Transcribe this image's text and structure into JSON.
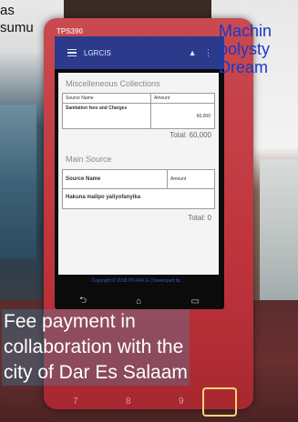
{
  "device": {
    "model": "TPS390",
    "app": {
      "title": "LGRCIS",
      "actions": "▲ ⋮"
    },
    "misc": {
      "title": "Miscelleneous Collections",
      "headers": [
        "Source Name",
        "Amount"
      ],
      "row_name": "Sanitation fees and Charges",
      "row_amount": "60,000",
      "total": "Total: 60,000"
    },
    "main": {
      "title": "Main Source",
      "headers": [
        "Source Name",
        "Amount"
      ],
      "empty_message": "Hakuna malipo yaliyofanyika",
      "total": "Total: 0"
    },
    "footer_link": "Copyright © 2018 PO-RALG | Developed by ...",
    "nav_icons": [
      "back-icon",
      "home-icon",
      "recents-icon"
    ]
  },
  "captions": {
    "top_left_1": "as",
    "top_left_2": "sumu",
    "top_right_1": "Machin",
    "top_right_2": "polysty",
    "top_right_3": "Dream",
    "bottom_1": "Fee payment in",
    "bottom_2": "collaboration with the",
    "bottom_3": "city of Dar Es Salaam"
  },
  "keypad": [
    "7",
    "8",
    "9"
  ]
}
